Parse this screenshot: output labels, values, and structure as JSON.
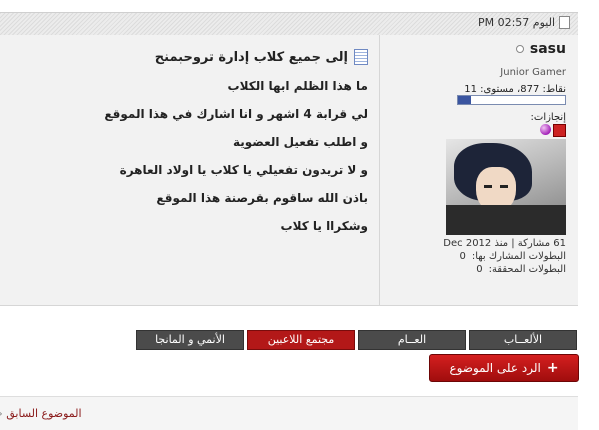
{
  "post": {
    "date": "اليوم 02:57 PM",
    "title": "إلى جميع كلاب إدارة تروحبمنح",
    "lines": [
      "ما هذا الظلم ابها الكلاب",
      "لي قرابة 4 اشهر و انا اشارك في هذا الموقع",
      "و اطلب تفعيل العضوية",
      "و لا تريدون تفعيلي يا كلاب يا اولاد العاهرة",
      "باذن الله ساقوم بقرصنة هذا الموقع",
      "وشكراا يا كلاب"
    ]
  },
  "user": {
    "name": "sasu",
    "title": "Junior Gamer",
    "points": "نقاط: 877، مستوى: 11",
    "level_fraction": 0.12,
    "badges_label": "إنجازات:",
    "posts_joined": "61 مشاركة | منذ Dec 2012",
    "tournaments_joined_label": "البطولات المشارك بها:",
    "tournaments_joined_value": "0",
    "tournaments_won_label": "البطولات المحققة:",
    "tournaments_won_value": "0"
  },
  "tags": [
    "الألعــاب",
    "العــام",
    "مجتمع اللاعبين",
    "الأنمي و المانجا"
  ],
  "reply_button": "الرد على الموضوع",
  "prev_thread": "الموضوع السابق",
  "colors": {
    "accent_red": "#b31818",
    "tag_dark": "#4b4b4b",
    "level_fill": "#3a55a0"
  }
}
